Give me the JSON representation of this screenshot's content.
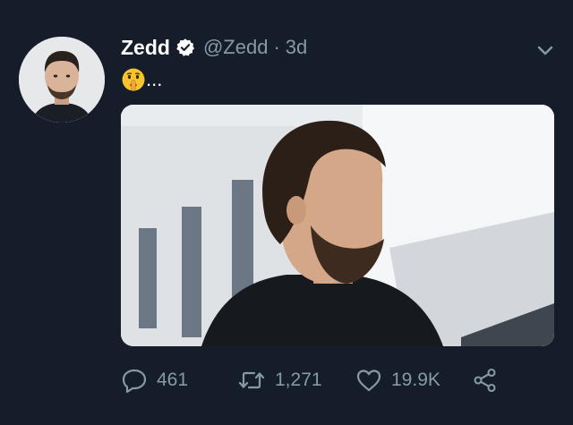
{
  "tweet": {
    "author_name": "Zedd",
    "handle": "@Zedd",
    "separator": "·",
    "time": "3d",
    "text": "...",
    "emoji": "shushing-face-emoji"
  },
  "actions": {
    "replies": "461",
    "retweets": "1,271",
    "likes": "19.9K"
  },
  "colors": {
    "background": "#151d2a",
    "secondary_text": "#8899a6",
    "primary_text": "#ffffff"
  }
}
